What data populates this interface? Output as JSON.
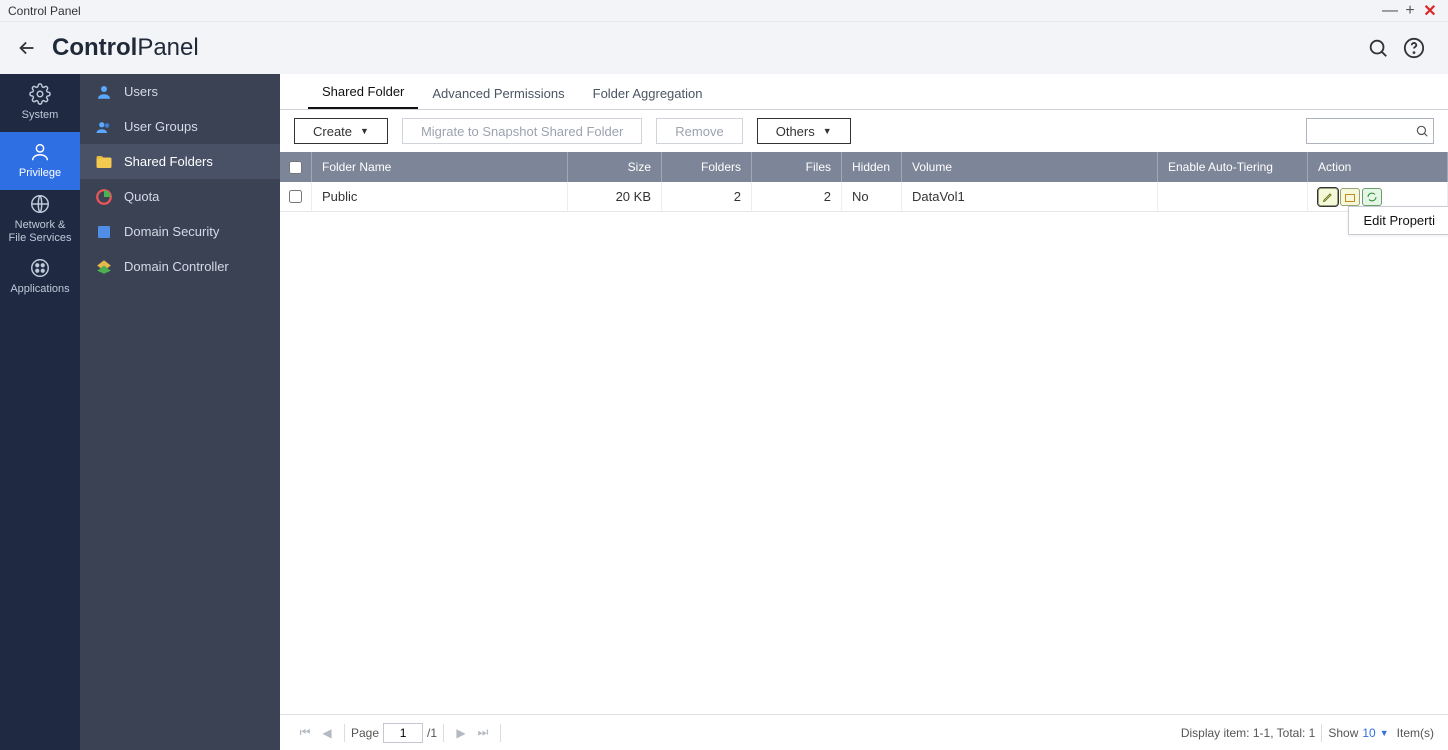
{
  "window": {
    "title": "Control Panel"
  },
  "header": {
    "app_name_bold": "Control",
    "app_name_rest": "Panel"
  },
  "rail": [
    {
      "key": "system",
      "label": "System"
    },
    {
      "key": "privilege",
      "label": "Privilege"
    },
    {
      "key": "network",
      "label": "Network &\nFile Services"
    },
    {
      "key": "applications",
      "label": "Applications"
    }
  ],
  "sidebar": [
    {
      "key": "users",
      "label": "Users"
    },
    {
      "key": "user-groups",
      "label": "User Groups"
    },
    {
      "key": "shared-folders",
      "label": "Shared Folders"
    },
    {
      "key": "quota",
      "label": "Quota"
    },
    {
      "key": "domain-security",
      "label": "Domain Security"
    },
    {
      "key": "domain-controller",
      "label": "Domain Controller"
    }
  ],
  "tabs": {
    "shared_folder": "Shared Folder",
    "advanced_permissions": "Advanced Permissions",
    "folder_aggregation": "Folder Aggregation"
  },
  "toolbar": {
    "create": "Create",
    "migrate": "Migrate to Snapshot Shared Folder",
    "remove": "Remove",
    "others": "Others"
  },
  "columns": {
    "folder_name": "Folder Name",
    "size": "Size",
    "folders": "Folders",
    "files": "Files",
    "hidden": "Hidden",
    "volume": "Volume",
    "auto_tiering": "Enable Auto-Tiering",
    "action": "Action"
  },
  "rows": [
    {
      "name": "Public",
      "size": "20 KB",
      "folders": "2",
      "files": "2",
      "hidden": "No",
      "volume": "DataVol1"
    }
  ],
  "tooltip": "Edit Properti",
  "pager": {
    "page_label": "Page",
    "page_current": "1",
    "page_total": "/1",
    "display": "Display item: 1-1, Total: 1",
    "show": "Show",
    "page_size": "10",
    "items": "Item(s)"
  }
}
